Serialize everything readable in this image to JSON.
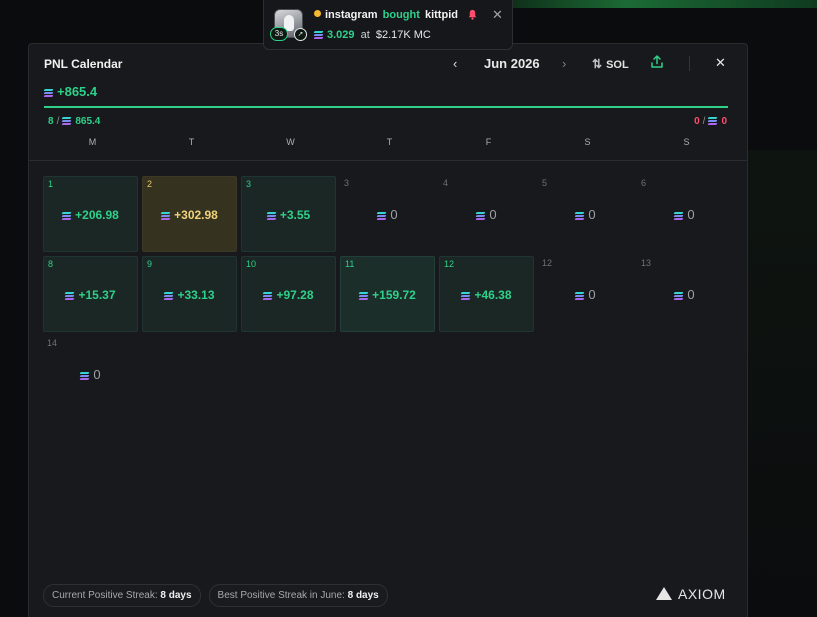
{
  "toast": {
    "age": "3s",
    "user": "instagram",
    "action": "bought",
    "token": "kittpid",
    "amount": "3.029",
    "at": "at",
    "market_cap": "$2.17K MC"
  },
  "panel": {
    "title": "PNL Calendar",
    "month": "Jun 2026",
    "currency": "SOL",
    "total": "+865.4",
    "progress_fraction": 1.0,
    "wins": {
      "count": "8",
      "amount": "865.4"
    },
    "losses": {
      "count": "0",
      "amount": "0"
    },
    "weekdays": [
      "M",
      "T",
      "W",
      "T",
      "F",
      "S",
      "S"
    ],
    "days": [
      {
        "day": "1",
        "value": "+206.98",
        "kind": "pos"
      },
      {
        "day": "2",
        "value": "+302.98",
        "kind": "gold"
      },
      {
        "day": "3",
        "value": "+3.55",
        "kind": "pos"
      },
      {
        "day": "3",
        "value": "0",
        "kind": "empty"
      },
      {
        "day": "4",
        "value": "0",
        "kind": "empty"
      },
      {
        "day": "5",
        "value": "0",
        "kind": "empty"
      },
      {
        "day": "6",
        "value": "0",
        "kind": "empty"
      },
      {
        "day": "8",
        "value": "+15.37",
        "kind": "pos"
      },
      {
        "day": "9",
        "value": "+33.13",
        "kind": "pos"
      },
      {
        "day": "10",
        "value": "+97.28",
        "kind": "pos"
      },
      {
        "day": "11",
        "value": "+159.72",
        "kind": "pos strong"
      },
      {
        "day": "12",
        "value": "+46.38",
        "kind": "pos"
      },
      {
        "day": "12",
        "value": "0",
        "kind": "empty"
      },
      {
        "day": "13",
        "value": "0",
        "kind": "empty"
      },
      {
        "day": "14",
        "value": "0",
        "kind": "empty"
      }
    ],
    "footer": {
      "current_streak_label": "Current Positive Streak:",
      "current_streak_value": "8 days",
      "best_streak_label": "Best Positive Streak in June:",
      "best_streak_value": "8 days"
    },
    "brand": "AXIOM"
  },
  "colors": {
    "positive": "#2fd08a",
    "negative": "#ff4d6d",
    "gold": "#f0d27a",
    "panel_bg": "#18191c"
  }
}
